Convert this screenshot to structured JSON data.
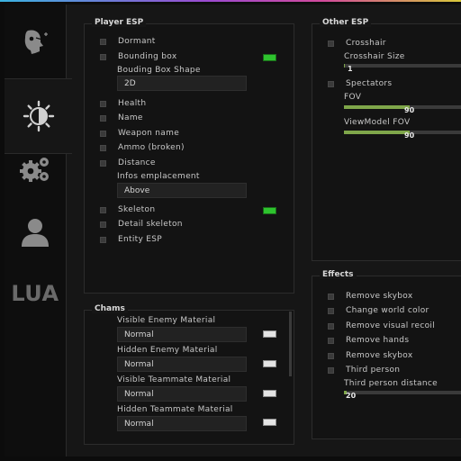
{
  "sidebar": {
    "tabs": [
      {
        "name": "aimbot",
        "icon": "head-aim-icon"
      },
      {
        "name": "visuals",
        "icon": "sun-half-icon",
        "active": true
      },
      {
        "name": "misc",
        "icon": "gears-icon"
      },
      {
        "name": "players",
        "icon": "user-icon"
      },
      {
        "name": "lua",
        "label": "LUA"
      }
    ]
  },
  "player_esp": {
    "title": "Player ESP",
    "dormant": "Dormant",
    "bounding_box": "Bounding box",
    "bounding_box_shape_label": "Bouding Box Shape",
    "bounding_box_shape_value": "2D",
    "health": "Health",
    "name": "Name",
    "weapon_name": "Weapon name",
    "ammo": "Ammo (broken)",
    "distance": "Distance",
    "infos_emplacement_label": "Infos emplacement",
    "infos_emplacement_value": "Above",
    "skeleton": "Skeleton",
    "detail_skeleton": "Detail skeleton",
    "entity_esp": "Entity ESP",
    "bounding_box_color": "#2ec32e",
    "skeleton_color": "#2ec32e"
  },
  "other_esp": {
    "title": "Other ESP",
    "crosshair": "Crosshair",
    "crosshair_size_label": "Crosshair Size",
    "crosshair_size_value": "1",
    "crosshair_size_fraction": 0.01,
    "spectators": "Spectators",
    "fov_label": "FOV",
    "fov_value": "90",
    "fov_fraction": 0.52,
    "viewmodel_fov_label": "ViewModel FOV",
    "viewmodel_fov_value": "90",
    "viewmodel_fov_fraction": 0.52
  },
  "chams": {
    "title": "Chams",
    "visible_enemy_label": "Visible Enemy Material",
    "visible_enemy_value": "Normal",
    "hidden_enemy_label": "Hidden Enemy Material",
    "hidden_enemy_value": "Normal",
    "visible_teammate_label": "Visible Teammate Material",
    "visible_teammate_value": "Normal",
    "hidden_teammate_label": "Hidden Teammate Material",
    "hidden_teammate_value": "Normal"
  },
  "effects": {
    "title": "Effects",
    "remove_skybox_1": "Remove skybox",
    "change_world_color": "Change world color",
    "remove_visual_recoil": "Remove visual recoil",
    "remove_hands": "Remove hands",
    "remove_skybox_2": "Remove skybox",
    "third_person": "Third person",
    "third_person_distance_label": "Third person distance",
    "third_person_distance_value": "20",
    "third_person_distance_fraction": 0.02
  },
  "colors": {
    "accent": "#7fa64a",
    "enabled": "#2ec32e"
  }
}
